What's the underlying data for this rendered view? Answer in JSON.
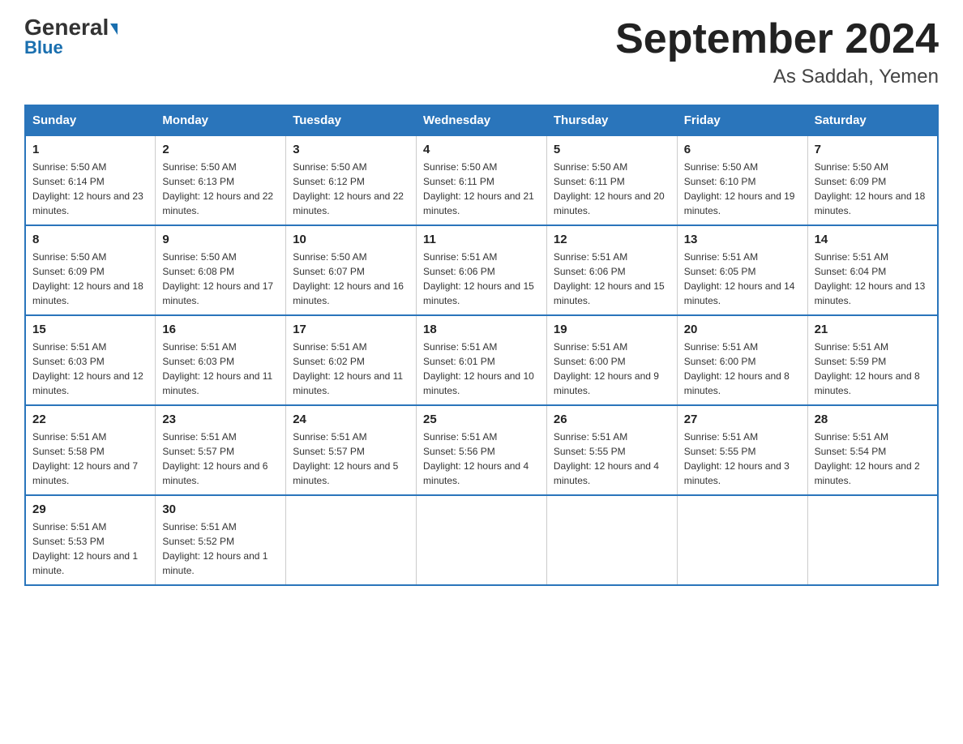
{
  "logo": {
    "line1_black": "General",
    "line1_blue_arrow": "▶",
    "line2": "Blue"
  },
  "title": {
    "month_year": "September 2024",
    "location": "As Saddah, Yemen"
  },
  "weekdays": [
    "Sunday",
    "Monday",
    "Tuesday",
    "Wednesday",
    "Thursday",
    "Friday",
    "Saturday"
  ],
  "weeks": [
    [
      {
        "day": "1",
        "sunrise": "5:50 AM",
        "sunset": "6:14 PM",
        "daylight": "12 hours and 23 minutes."
      },
      {
        "day": "2",
        "sunrise": "5:50 AM",
        "sunset": "6:13 PM",
        "daylight": "12 hours and 22 minutes."
      },
      {
        "day": "3",
        "sunrise": "5:50 AM",
        "sunset": "6:12 PM",
        "daylight": "12 hours and 22 minutes."
      },
      {
        "day": "4",
        "sunrise": "5:50 AM",
        "sunset": "6:11 PM",
        "daylight": "12 hours and 21 minutes."
      },
      {
        "day": "5",
        "sunrise": "5:50 AM",
        "sunset": "6:11 PM",
        "daylight": "12 hours and 20 minutes."
      },
      {
        "day": "6",
        "sunrise": "5:50 AM",
        "sunset": "6:10 PM",
        "daylight": "12 hours and 19 minutes."
      },
      {
        "day": "7",
        "sunrise": "5:50 AM",
        "sunset": "6:09 PM",
        "daylight": "12 hours and 18 minutes."
      }
    ],
    [
      {
        "day": "8",
        "sunrise": "5:50 AM",
        "sunset": "6:09 PM",
        "daylight": "12 hours and 18 minutes."
      },
      {
        "day": "9",
        "sunrise": "5:50 AM",
        "sunset": "6:08 PM",
        "daylight": "12 hours and 17 minutes."
      },
      {
        "day": "10",
        "sunrise": "5:50 AM",
        "sunset": "6:07 PM",
        "daylight": "12 hours and 16 minutes."
      },
      {
        "day": "11",
        "sunrise": "5:51 AM",
        "sunset": "6:06 PM",
        "daylight": "12 hours and 15 minutes."
      },
      {
        "day": "12",
        "sunrise": "5:51 AM",
        "sunset": "6:06 PM",
        "daylight": "12 hours and 15 minutes."
      },
      {
        "day": "13",
        "sunrise": "5:51 AM",
        "sunset": "6:05 PM",
        "daylight": "12 hours and 14 minutes."
      },
      {
        "day": "14",
        "sunrise": "5:51 AM",
        "sunset": "6:04 PM",
        "daylight": "12 hours and 13 minutes."
      }
    ],
    [
      {
        "day": "15",
        "sunrise": "5:51 AM",
        "sunset": "6:03 PM",
        "daylight": "12 hours and 12 minutes."
      },
      {
        "day": "16",
        "sunrise": "5:51 AM",
        "sunset": "6:03 PM",
        "daylight": "12 hours and 11 minutes."
      },
      {
        "day": "17",
        "sunrise": "5:51 AM",
        "sunset": "6:02 PM",
        "daylight": "12 hours and 11 minutes."
      },
      {
        "day": "18",
        "sunrise": "5:51 AM",
        "sunset": "6:01 PM",
        "daylight": "12 hours and 10 minutes."
      },
      {
        "day": "19",
        "sunrise": "5:51 AM",
        "sunset": "6:00 PM",
        "daylight": "12 hours and 9 minutes."
      },
      {
        "day": "20",
        "sunrise": "5:51 AM",
        "sunset": "6:00 PM",
        "daylight": "12 hours and 8 minutes."
      },
      {
        "day": "21",
        "sunrise": "5:51 AM",
        "sunset": "5:59 PM",
        "daylight": "12 hours and 8 minutes."
      }
    ],
    [
      {
        "day": "22",
        "sunrise": "5:51 AM",
        "sunset": "5:58 PM",
        "daylight": "12 hours and 7 minutes."
      },
      {
        "day": "23",
        "sunrise": "5:51 AM",
        "sunset": "5:57 PM",
        "daylight": "12 hours and 6 minutes."
      },
      {
        "day": "24",
        "sunrise": "5:51 AM",
        "sunset": "5:57 PM",
        "daylight": "12 hours and 5 minutes."
      },
      {
        "day": "25",
        "sunrise": "5:51 AM",
        "sunset": "5:56 PM",
        "daylight": "12 hours and 4 minutes."
      },
      {
        "day": "26",
        "sunrise": "5:51 AM",
        "sunset": "5:55 PM",
        "daylight": "12 hours and 4 minutes."
      },
      {
        "day": "27",
        "sunrise": "5:51 AM",
        "sunset": "5:55 PM",
        "daylight": "12 hours and 3 minutes."
      },
      {
        "day": "28",
        "sunrise": "5:51 AM",
        "sunset": "5:54 PM",
        "daylight": "12 hours and 2 minutes."
      }
    ],
    [
      {
        "day": "29",
        "sunrise": "5:51 AM",
        "sunset": "5:53 PM",
        "daylight": "12 hours and 1 minute."
      },
      {
        "day": "30",
        "sunrise": "5:51 AM",
        "sunset": "5:52 PM",
        "daylight": "12 hours and 1 minute."
      },
      null,
      null,
      null,
      null,
      null
    ]
  ]
}
